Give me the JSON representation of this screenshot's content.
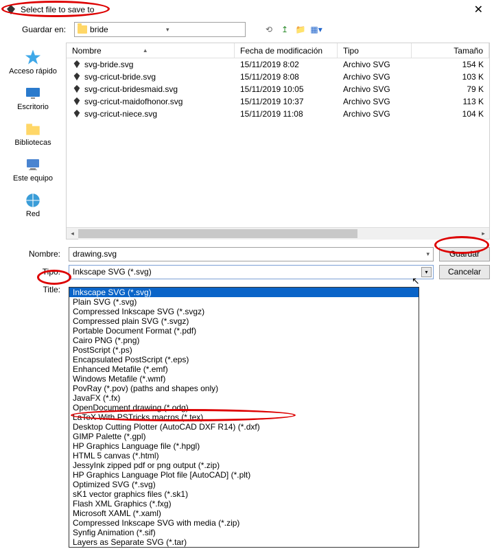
{
  "title": "Select file to save to",
  "toolbar": {
    "save_in_label": "Guardar en:",
    "folder_name": "bride"
  },
  "sidebar": [
    {
      "label": "Acceso rápido",
      "icon": "star"
    },
    {
      "label": "Escritorio",
      "icon": "desktop"
    },
    {
      "label": "Bibliotecas",
      "icon": "libraries"
    },
    {
      "label": "Este equipo",
      "icon": "computer"
    },
    {
      "label": "Red",
      "icon": "network"
    }
  ],
  "columns": {
    "name": "Nombre",
    "date": "Fecha de modificación",
    "type": "Tipo",
    "size": "Tamaño"
  },
  "files": [
    {
      "name": "svg-bride.svg",
      "date": "15/11/2019 8:02",
      "type": "Archivo SVG",
      "size": "154 K"
    },
    {
      "name": "svg-cricut-bride.svg",
      "date": "15/11/2019 8:08",
      "type": "Archivo SVG",
      "size": "103 K"
    },
    {
      "name": "svg-cricut-bridesmaid.svg",
      "date": "15/11/2019 10:05",
      "type": "Archivo SVG",
      "size": "79 K"
    },
    {
      "name": "svg-cricut-maidofhonor.svg",
      "date": "15/11/2019 10:37",
      "type": "Archivo SVG",
      "size": "113 K"
    },
    {
      "name": "svg-cricut-niece.svg",
      "date": "15/11/2019 11:08",
      "type": "Archivo SVG",
      "size": "104 K"
    }
  ],
  "form": {
    "name_label": "Nombre:",
    "name_value": "drawing.svg",
    "type_label": "Tipo:",
    "type_value": "Inkscape SVG (*.svg)",
    "title_label": "Title:",
    "save_btn": "Guardar",
    "cancel_btn": "Cancelar"
  },
  "type_options": [
    "Inkscape SVG (*.svg)",
    "Plain SVG (*.svg)",
    "Compressed Inkscape SVG (*.svgz)",
    "Compressed plain SVG (*.svgz)",
    "Portable Document Format (*.pdf)",
    "Cairo PNG (*.png)",
    "PostScript (*.ps)",
    "Encapsulated PostScript (*.eps)",
    "Enhanced Metafile (*.emf)",
    "Windows Metafile (*.wmf)",
    "PovRay (*.pov) (paths and shapes only)",
    "JavaFX (*.fx)",
    "OpenDocument drawing (*.odg)",
    "LaTeX With PSTricks macros (*.tex)",
    "Desktop Cutting Plotter (AutoCAD DXF R14) (*.dxf)",
    "GIMP Palette (*.gpl)",
    "HP Graphics Language file (*.hpgl)",
    "HTML 5 canvas (*.html)",
    "JessyInk zipped pdf or png output (*.zip)",
    "HP Graphics Language Plot file [AutoCAD] (*.plt)",
    "Optimized SVG (*.svg)",
    "sK1 vector graphics files (*.sk1)",
    "Flash XML Graphics (*.fxg)",
    "Microsoft XAML (*.xaml)",
    "Compressed Inkscape SVG with media (*.zip)",
    "Synfig Animation (*.sif)",
    "Layers as Separate SVG (*.tar)"
  ]
}
